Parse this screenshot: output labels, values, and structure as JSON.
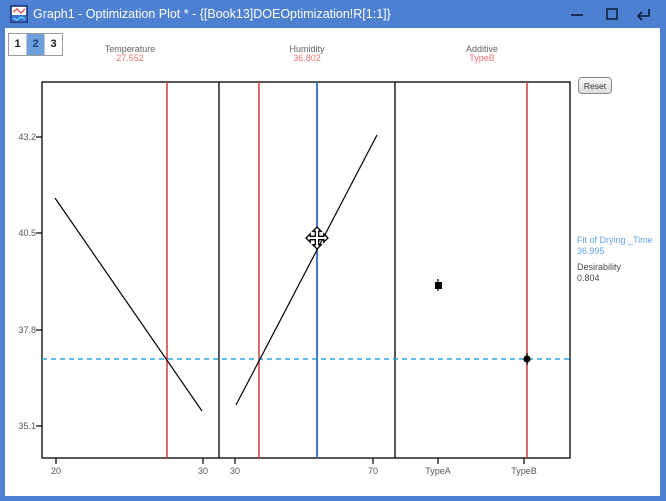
{
  "window": {
    "title": "Graph1 - Optimization Plot * - {[Book13]DOEOptimization!R[1:1]}",
    "icon": "graph-window-icon",
    "controls": {
      "minimize": "minimize",
      "maximize": "maximize",
      "close_return": "return"
    }
  },
  "toolbar": {
    "tabs": [
      {
        "label": "1",
        "selected": false
      },
      {
        "label": "2",
        "selected": true
      },
      {
        "label": "3",
        "selected": false
      }
    ],
    "reset_label": "Reset"
  },
  "factors": [
    {
      "name": "Temperature",
      "value": "27.552"
    },
    {
      "name": "Humidity",
      "value": "36.802"
    },
    {
      "name": "Additive",
      "value": "TypeB"
    }
  ],
  "results": {
    "fit_label": "Fit of Drying _Time",
    "fit_value": "36.995",
    "desirability_label": "Desirability",
    "desirability_value": "0.804"
  },
  "colors": {
    "titlebar": "#4d80d0",
    "selected_tab": "#6d9fdd",
    "current_value_line": "#d43a3a",
    "factor_value_text": "#ee7474",
    "drag_line": "#2f6cc9",
    "predicted_dash_line": "#2aa8e0",
    "fit_text": "#64a4e6"
  },
  "chart_data": {
    "type": "line",
    "title": "",
    "ylabel": "",
    "y_tick_labels": [
      "43.2",
      "40.5",
      "37.8",
      "35.1"
    ],
    "ylim": [
      34.2,
      44.7
    ],
    "grid": false,
    "legend": "none",
    "reference_line": {
      "label": "predicted response",
      "value": 36.995,
      "style": "dashed"
    },
    "panels": [
      {
        "factor": "Temperature",
        "x_tick_labels": [
          "20",
          "30"
        ],
        "xlim": [
          19.0,
          31.1
        ],
        "current_value": 27.552,
        "line": {
          "x": [
            19.9,
            29.9
          ],
          "y": [
            41.5,
            35.5
          ]
        }
      },
      {
        "factor": "Humidity",
        "x_tick_labels": [
          "30",
          "70"
        ],
        "xlim": [
          25.4,
          76.4
        ],
        "current_value": 36.802,
        "drag_line_position": 53.8,
        "line": {
          "x": [
            30.3,
            71.2
          ],
          "y": [
            35.7,
            43.3
          ]
        }
      },
      {
        "factor": "Additive",
        "x_tick_labels": [
          "TypeA",
          "TypeB"
        ],
        "current_value": "TypeB",
        "points": [
          {
            "x": "TypeA",
            "y": 39.05
          },
          {
            "x": "TypeB",
            "y": 36.99
          }
        ]
      }
    ]
  }
}
